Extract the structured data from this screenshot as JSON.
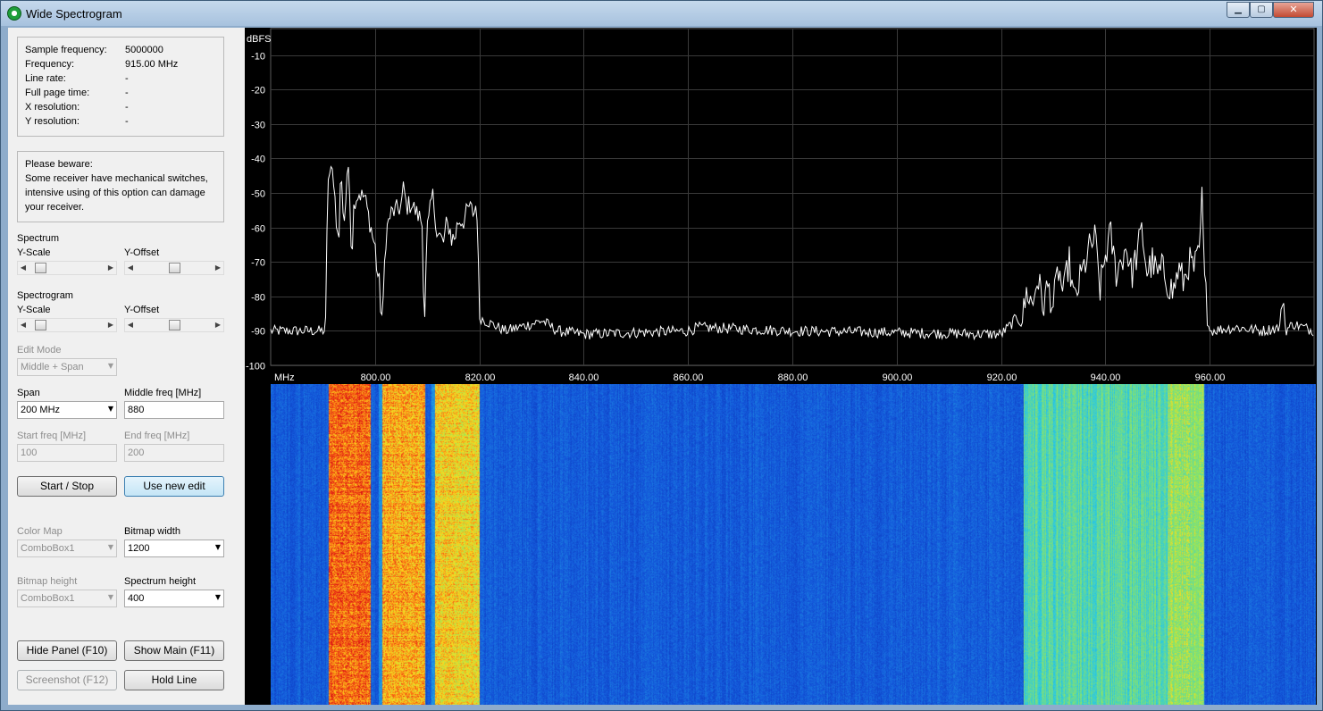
{
  "window": {
    "title": "Wide Spectrogram",
    "icon": "app-eye-icon",
    "controls": {
      "minimize": "▁",
      "maximize": "▢",
      "close": "✕"
    }
  },
  "info": {
    "rows": [
      {
        "label": "Sample frequency:",
        "value": "5000000"
      },
      {
        "label": "Frequency:",
        "value": "915.00 MHz"
      },
      {
        "label": "Line rate:",
        "value": "-"
      },
      {
        "label": "Full page time:",
        "value": "-"
      },
      {
        "label": "X resolution:",
        "value": "-"
      },
      {
        "label": "Y resolution:",
        "value": "-"
      }
    ]
  },
  "warning": {
    "lines": [
      "Please beware:",
      "Some receiver have mechanical switches,",
      "intensive using of this option can damage",
      "your receiver."
    ]
  },
  "spectrum_section": {
    "title": "Spectrum",
    "yscale_label": "Y-Scale",
    "yoffset_label": "Y-Offset",
    "yscale_level": 0.1,
    "yoffset_level": 0.5
  },
  "spectrogram_section": {
    "title": "Spectrogram",
    "yscale_label": "Y-Scale",
    "yoffset_label": "Y-Offset",
    "yscale_level": 0.1,
    "yoffset_level": 0.5
  },
  "edit_mode": {
    "label": "Edit Mode",
    "value": "Middle + Span"
  },
  "span": {
    "label": "Span",
    "value": "200 MHz"
  },
  "middle_freq": {
    "label": "Middle freq [MHz]",
    "value": "880"
  },
  "start_freq": {
    "label": "Start freq [MHz]",
    "value": "100"
  },
  "end_freq": {
    "label": "End freq [MHz]",
    "value": "200"
  },
  "buttons": {
    "start_stop": "Start / Stop",
    "use_new_edit": "Use new edit",
    "hide_panel": "Hide Panel (F10)",
    "show_main": "Show Main (F11)",
    "screenshot": "Screenshot (F12)",
    "hold_line": "Hold Line"
  },
  "color_map": {
    "label": "Color Map",
    "value": "ComboBox1"
  },
  "bitmap_width": {
    "label": "Bitmap width",
    "value": "1200"
  },
  "bitmap_height": {
    "label": "Bitmap height",
    "value": "ComboBox1"
  },
  "spectrum_height": {
    "label": "Spectrum height",
    "value": "400"
  },
  "chart_data": {
    "type": "line",
    "ylabel": "dBFS",
    "xlabel": "MHz",
    "ylim": [
      -100,
      -2.3
    ],
    "yticks": [
      -10,
      -20,
      -30,
      -40,
      -50,
      -60,
      -70,
      -80,
      -90,
      -100
    ],
    "xlim": [
      780,
      980
    ],
    "xticks": [
      800,
      820,
      840,
      860,
      880,
      900,
      920,
      940,
      960
    ],
    "xtick_labels": [
      "800.00",
      "820.00",
      "840.00",
      "860.00",
      "880.00",
      "900.00",
      "920.00",
      "940.00",
      "960.00"
    ],
    "grid": true,
    "line_color": "#ffffff",
    "series": [
      {
        "x": [
          780,
          788,
          790.5,
          791,
          792,
          793,
          793.5,
          794,
          795,
          795.5,
          796,
          797,
          797.5,
          798,
          800,
          801.5,
          802,
          803,
          804,
          805,
          805.5,
          806,
          807,
          808,
          809,
          809.5,
          810,
          811,
          812,
          813,
          814,
          815,
          816,
          817,
          818,
          819,
          819.5,
          820,
          821,
          825,
          830,
          832,
          835,
          840,
          860,
          862,
          880,
          920,
          922,
          923,
          924,
          925,
          926,
          927,
          928,
          929,
          930,
          931,
          932,
          933,
          934,
          935,
          936,
          937,
          938,
          939,
          940,
          941,
          942,
          943,
          944,
          945,
          946,
          947,
          948,
          949,
          950,
          951,
          952,
          953,
          954,
          955,
          956,
          957,
          958,
          958.5,
          959,
          960,
          965,
          970,
          973.5,
          974,
          974.5,
          976,
          980
        ],
        "y": [
          -90,
          -90,
          -90,
          -45,
          -44,
          -67,
          -41,
          -60,
          -40,
          -68,
          -52,
          -50,
          -51,
          -51,
          -66,
          -88,
          -62,
          -56,
          -55,
          -54,
          -48,
          -54,
          -53,
          -56,
          -58,
          -86,
          -62,
          -50,
          -62,
          -65,
          -59,
          -64,
          -58,
          -58,
          -54,
          -56,
          -52,
          -86,
          -87,
          -90,
          -88,
          -87,
          -90,
          -91,
          -90,
          -89,
          -90,
          -91,
          -88,
          -86,
          -88,
          -78,
          -83,
          -74,
          -83,
          -77,
          -83,
          -72,
          -80,
          -69,
          -82,
          -76,
          -71,
          -66,
          -63,
          -78,
          -68,
          -62,
          -73,
          -70,
          -65,
          -74,
          -68,
          -61,
          -73,
          -70,
          -74,
          -72,
          -76,
          -79,
          -72,
          -76,
          -70,
          -72,
          -68,
          -50,
          -76,
          -90,
          -89,
          -90,
          -89,
          -77,
          -90,
          -88,
          -90
        ]
      }
    ],
    "spectrogram": {
      "x_range_mhz": [
        780,
        980
      ],
      "hot_bands_mhz": [
        [
          791,
          799
        ],
        [
          801,
          809.5
        ],
        [
          811,
          820
        ],
        [
          924,
          958.5
        ]
      ]
    }
  }
}
